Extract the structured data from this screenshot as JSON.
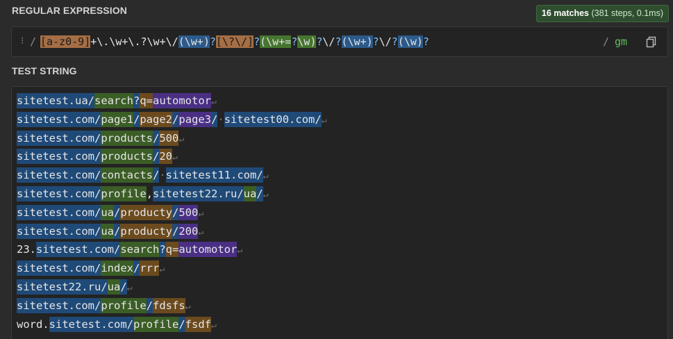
{
  "regex_section": {
    "title": "REGULAR EXPRESSION",
    "drag_handle": "⁝",
    "delimiter_open": "/",
    "delimiter_close": "/",
    "flags": "gm",
    "tokens": [
      {
        "t": "[a-z0-9]",
        "c": "set"
      },
      {
        "t": "+\\.\\w+\\.?\\w+\\/",
        "c": "esc"
      },
      {
        "t": "(",
        "c": "g1"
      },
      {
        "t": "\\w+",
        "c": "g1"
      },
      {
        "t": ")",
        "c": "g1"
      },
      {
        "t": "?",
        "c": "q"
      },
      {
        "t": "[\\?\\/]",
        "c": "set"
      },
      {
        "t": "?",
        "c": "q"
      },
      {
        "t": "(",
        "c": "g2"
      },
      {
        "t": "\\w+=",
        "c": "g2"
      },
      {
        "t": "?",
        "c": "q"
      },
      {
        "t": "\\w",
        "c": "g2"
      },
      {
        "t": ")",
        "c": "g2"
      },
      {
        "t": "?",
        "c": "q"
      },
      {
        "t": "\\/",
        "c": "esc"
      },
      {
        "t": "?",
        "c": "q"
      },
      {
        "t": "(",
        "c": "g3"
      },
      {
        "t": "\\w+",
        "c": "g3"
      },
      {
        "t": ")",
        "c": "g3"
      },
      {
        "t": "?",
        "c": "q"
      },
      {
        "t": "\\/",
        "c": "esc"
      },
      {
        "t": "?",
        "c": "q"
      },
      {
        "t": "(",
        "c": "g5"
      },
      {
        "t": "\\w",
        "c": "g5"
      },
      {
        "t": ")",
        "c": "g5"
      },
      {
        "t": "?",
        "c": "q"
      }
    ]
  },
  "match_info": {
    "count_label": "16 matches",
    "detail": "(381 steps, 0.1ms)"
  },
  "test_section": {
    "title": "TEST STRING",
    "eol_symbol": "↵",
    "lines": [
      [
        [
          "sitetest.ua/",
          "m"
        ],
        [
          "search",
          "g1"
        ],
        [
          "?",
          "m"
        ],
        [
          "q=",
          "g2"
        ],
        [
          "automotor",
          "g3"
        ]
      ],
      [
        [
          "sitetest.com/",
          "m"
        ],
        [
          "page1",
          "g1"
        ],
        [
          "/",
          "m"
        ],
        [
          "page2",
          "g2"
        ],
        [
          "/",
          "m"
        ],
        [
          "page3",
          "g3"
        ],
        [
          "/",
          "m"
        ],
        [
          "·",
          "dot"
        ],
        [
          "sitetest00.com/",
          "m"
        ]
      ],
      [
        [
          "sitetest.com/",
          "m"
        ],
        [
          "products",
          "g1"
        ],
        [
          "/",
          "m"
        ],
        [
          "500",
          "g2"
        ]
      ],
      [
        [
          "sitetest.com/",
          "m"
        ],
        [
          "products",
          "g1"
        ],
        [
          "/",
          "m"
        ],
        [
          "20",
          "g2"
        ]
      ],
      [
        [
          "sitetest.com/",
          "m"
        ],
        [
          "contacts",
          "g1"
        ],
        [
          "/",
          "m"
        ],
        [
          "·",
          "dot"
        ],
        [
          "sitetest11.com/",
          "m"
        ]
      ],
      [
        [
          "sitetest.com/",
          "m"
        ],
        [
          "profile",
          "g1"
        ],
        [
          ",",
          "plain"
        ],
        [
          "sitetest22.ru/",
          "m"
        ],
        [
          "ua",
          "g1"
        ],
        [
          "/",
          "m"
        ]
      ],
      [
        [
          "sitetest.com/",
          "m"
        ],
        [
          "ua",
          "g1"
        ],
        [
          "/",
          "m"
        ],
        [
          "producty",
          "g2"
        ],
        [
          "/",
          "m"
        ],
        [
          "500",
          "g3"
        ]
      ],
      [
        [
          "sitetest.com/",
          "m"
        ],
        [
          "ua",
          "g1"
        ],
        [
          "/",
          "m"
        ],
        [
          "producty",
          "g2"
        ],
        [
          "/",
          "m"
        ],
        [
          "200",
          "g3"
        ]
      ],
      [
        [
          "23.",
          "plain"
        ],
        [
          "sitetest.com/",
          "m"
        ],
        [
          "search",
          "g1"
        ],
        [
          "?",
          "m"
        ],
        [
          "q=",
          "g2"
        ],
        [
          "automotor",
          "g3"
        ]
      ],
      [
        [
          "sitetest.com/",
          "m"
        ],
        [
          "index",
          "g1"
        ],
        [
          "/",
          "m"
        ],
        [
          "rrr",
          "g2"
        ]
      ],
      [
        [
          "sitetest22.ru/",
          "m"
        ],
        [
          "ua",
          "g1"
        ],
        [
          "/",
          "m"
        ]
      ],
      [
        [
          "sitetest.com/",
          "m"
        ],
        [
          "profile",
          "g1"
        ],
        [
          "/",
          "m"
        ],
        [
          "fdsfs",
          "g2"
        ]
      ],
      [
        [
          "word.",
          "plain"
        ],
        [
          "sitetest.com/",
          "m"
        ],
        [
          "profile",
          "g1"
        ],
        [
          "/",
          "m"
        ],
        [
          "fsdf",
          "g2"
        ]
      ]
    ]
  }
}
